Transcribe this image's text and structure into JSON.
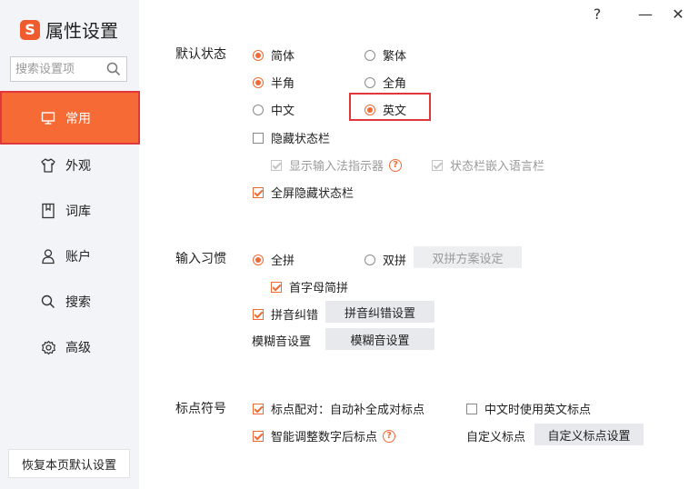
{
  "app": {
    "logo_letter": "S",
    "title": "属性设置"
  },
  "window_controls": {
    "help": "?",
    "minimize": "—",
    "close": "✕"
  },
  "search": {
    "placeholder": "搜索设置项"
  },
  "sidebar": {
    "items": [
      {
        "label": "常用",
        "icon": "monitor-icon",
        "active": true
      },
      {
        "label": "外观",
        "icon": "shirt-icon",
        "active": false
      },
      {
        "label": "词库",
        "icon": "book-icon",
        "active": false
      },
      {
        "label": "账户",
        "icon": "user-icon",
        "active": false
      },
      {
        "label": "搜索",
        "icon": "search-icon",
        "active": false
      },
      {
        "label": "高级",
        "icon": "gear-icon",
        "active": false
      }
    ],
    "restore_label": "恢复本页默认设置"
  },
  "default_state": {
    "title": "默认状态",
    "simplified": "简体",
    "traditional": "繁体",
    "half_width": "半角",
    "full_width": "全角",
    "chinese": "中文",
    "english": "英文",
    "hide_status_bar": "隐藏状态栏",
    "show_ime_indicator": "显示输入法指示器",
    "status_bar_in_langbar": "状态栏嵌入语言栏",
    "fullscreen_hide_status_bar": "全屏隐藏状态栏"
  },
  "input_habit": {
    "title": "输入习惯",
    "full_pinyin": "全拼",
    "double_pinyin": "双拼",
    "double_pinyin_scheme_button": "双拼方案设定",
    "initial_letter_pinyin": "首字母简拼",
    "pinyin_correction": "拼音纠错",
    "pinyin_correction_button": "拼音纠错设置",
    "fuzzy_sound_label": "模糊音设置",
    "fuzzy_sound_button": "模糊音设置"
  },
  "punctuation": {
    "title": "标点符号",
    "auto_pair": "标点配对：自动补全成对标点",
    "english_punct_in_chinese": "中文时使用英文标点",
    "smart_number_punct": "智能调整数字后标点",
    "custom_punct_label": "自定义标点",
    "custom_punct_button": "自定义标点设置"
  },
  "colors": {
    "accent": "#f56a35",
    "highlight": "#e0383a",
    "sidebar_bg": "#f3f4f7"
  }
}
